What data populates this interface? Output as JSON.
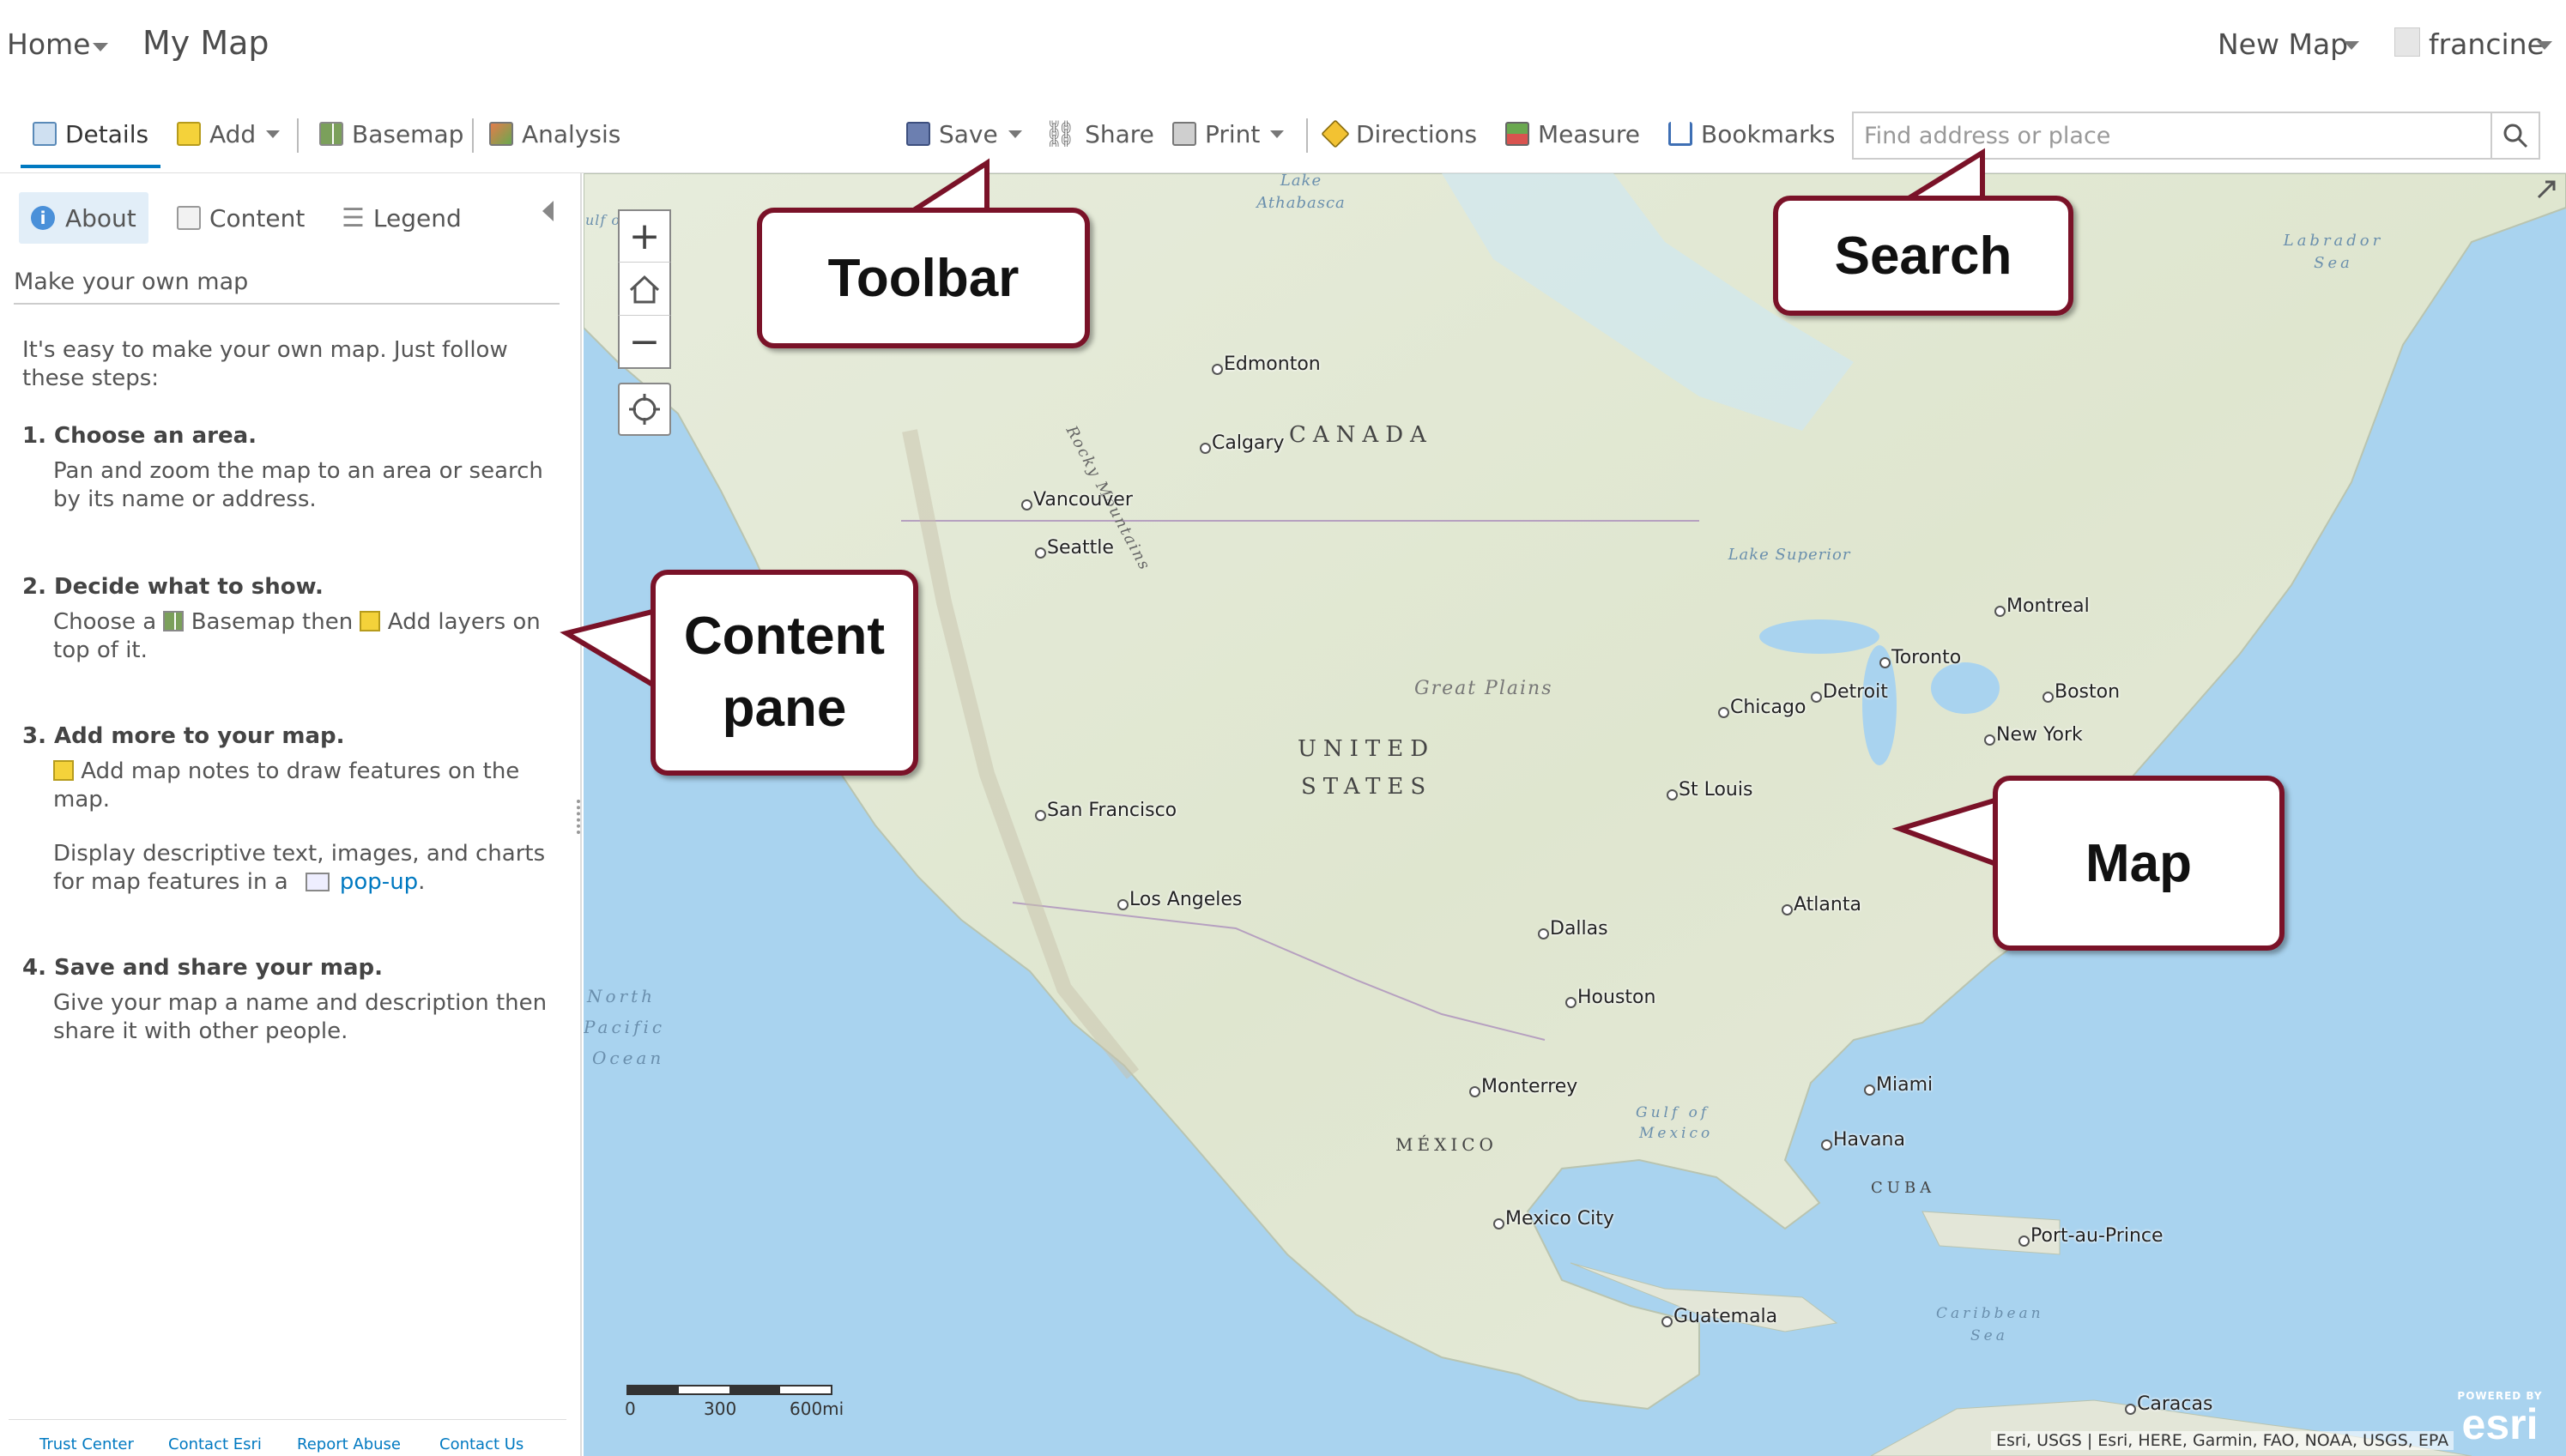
{
  "topbar": {
    "home_label": "Home",
    "app_title": "My Map",
    "new_map_label": "New Map",
    "user_name": "francine"
  },
  "toolbar": {
    "details": "Details",
    "add": "Add",
    "basemap": "Basemap",
    "analysis": "Analysis",
    "save": "Save",
    "share": "Share",
    "print": "Print",
    "directions": "Directions",
    "measure": "Measure",
    "bookmarks": "Bookmarks",
    "search_placeholder": "Find address or place"
  },
  "pane": {
    "tabs": {
      "about": "About",
      "content": "Content",
      "legend": "Legend"
    },
    "map_title": "Make your own map",
    "intro": "It's easy to make your own map. Just follow these steps:",
    "steps": [
      {
        "heading": "1. Choose an area.",
        "body": "Pan and zoom the map to an area or search by its name or address."
      },
      {
        "heading": "2. Decide what to show.",
        "body_a": "Choose a",
        "body_b": "Basemap then",
        "body_c": "Add layers on top of it."
      },
      {
        "heading": "3. Add more to your map.",
        "body": "Add map notes to draw features on the map.",
        "body2_a": "Display descriptive text, images, and charts for map features in a",
        "body2_link": "pop-up",
        "body2_end": "."
      },
      {
        "heading": "4. Save and share your map.",
        "body": "Give your map a name and description then share it with other people."
      }
    ],
    "footer": [
      "Trust Center",
      "Contact Esri",
      "Report Abuse",
      "Contact Us"
    ]
  },
  "map": {
    "regions": {
      "canada": "CANADA",
      "us1": "UNITED",
      "us2": "STATES",
      "mexico": "MÉXICO",
      "cuba": "CUBA",
      "great_plains": "Great Plains"
    },
    "water": {
      "athabasca": "Lake Athabasca",
      "labrador": "Labrador Sea",
      "superior": "Lake Superior",
      "pacific1": "North",
      "pacific2": "Pacific",
      "pacific3": "Ocean",
      "gulf1": "Gulf of",
      "gulf2": "Mexico",
      "caribbean1": "Caribbean",
      "caribbean2": "Sea",
      "rocky": "Rocky Mountains",
      "alaska": "ulf o"
    },
    "cities": [
      "Edmonton",
      "Calgary",
      "Vancouver",
      "Seattle",
      "Montreal",
      "Toronto",
      "Detroit",
      "Chicago",
      "Boston",
      "New York",
      "St Louis",
      "San Francisco",
      "Los Angeles",
      "Atlanta",
      "Dallas",
      "Houston",
      "Monterrey",
      "Miami",
      "Havana",
      "Mexico City",
      "Port-au-Prince",
      "Guatemala",
      "Caracas"
    ],
    "scale": {
      "zero": "0",
      "mid": "300",
      "end": "600mi"
    },
    "attribution": "Esri, USGS | Esri, HERE, Garmin, FAO, NOAA, USGS, EPA",
    "powered_by": "POWERED BY",
    "esri": "esri"
  },
  "callouts": {
    "toolbar": "Toolbar",
    "search": "Search",
    "content1": "Content",
    "content2": "pane",
    "map": "Map"
  },
  "colors": {
    "callout_border": "#7a1228",
    "link": "#0079c1",
    "water": "#a9d3ef",
    "land": "#e6ead8"
  }
}
